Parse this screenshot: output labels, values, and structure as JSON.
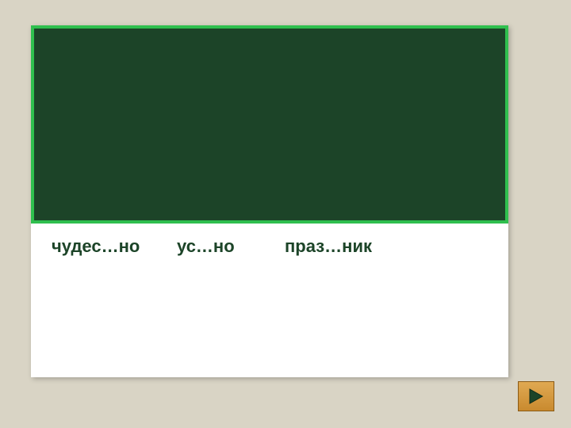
{
  "words": {
    "w1": "чудес…но",
    "w2": "ус…но",
    "w3": "праз…ник"
  },
  "nav": {
    "next": "next"
  }
}
